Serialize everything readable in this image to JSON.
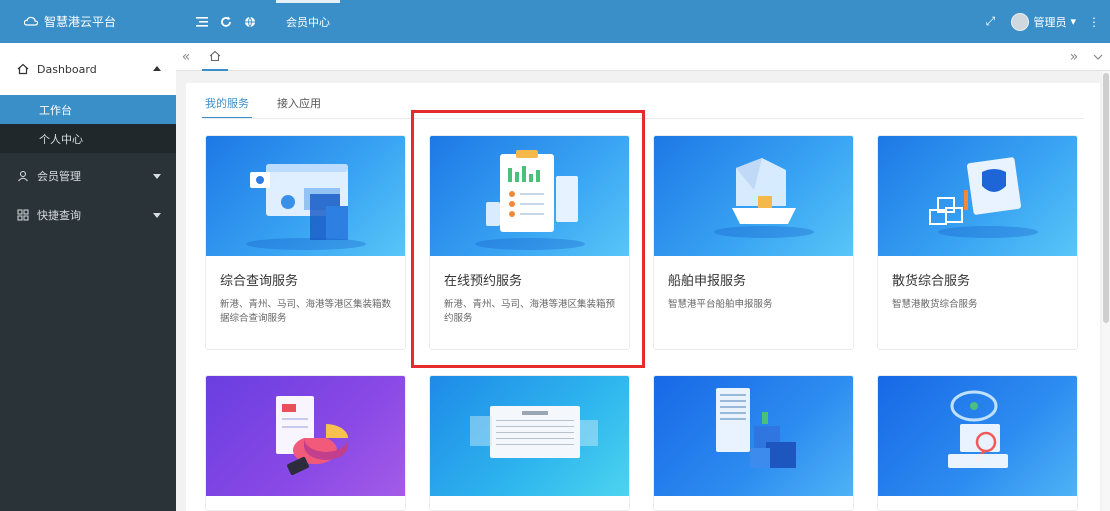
{
  "app": {
    "title": "智慧港云平台",
    "tab_label": "会员中心",
    "user_label": "管理员",
    "user_caret": "▾",
    "more_icon": "⋮",
    "expand_icon": "⤢"
  },
  "sidebar": {
    "group_label": "Dashboard",
    "items": [
      {
        "label": "工作台"
      },
      {
        "label": "个人中心"
      }
    ],
    "menus": [
      {
        "label": "会员管理",
        "icon": "user-icon"
      },
      {
        "label": "快捷查询",
        "icon": "query-icon"
      }
    ]
  },
  "main": {
    "tabs": [
      {
        "label": "我的服务"
      },
      {
        "label": "接入应用"
      }
    ],
    "cards": [
      {
        "title": "综合查询服务",
        "desc": "新港、青州、马司、海港等港区集装箱数据综合查询服务",
        "theme": "#1d78e6"
      },
      {
        "title": "在线预约服务",
        "desc": "新港、青州、马司、海港等港区集装箱预约服务",
        "theme": "#1d78e6"
      },
      {
        "title": "船舶申报服务",
        "desc": "智慧港平台船舶申报服务",
        "theme": "#1d78e6"
      },
      {
        "title": "散货综合服务",
        "desc": "智慧港散货综合服务",
        "theme": "#1d78e6"
      },
      {
        "title": "",
        "desc": "",
        "theme": "#6a3ee0"
      },
      {
        "title": "",
        "desc": "",
        "theme": "#1e8ae8"
      },
      {
        "title": "",
        "desc": "",
        "theme": "#1768e6"
      },
      {
        "title": "",
        "desc": "",
        "theme": "#1768e6"
      }
    ]
  },
  "colors": {
    "accent": "#3a8fc9",
    "sidebar_bg": "#2a3338",
    "highlight": "#e52b2b"
  }
}
